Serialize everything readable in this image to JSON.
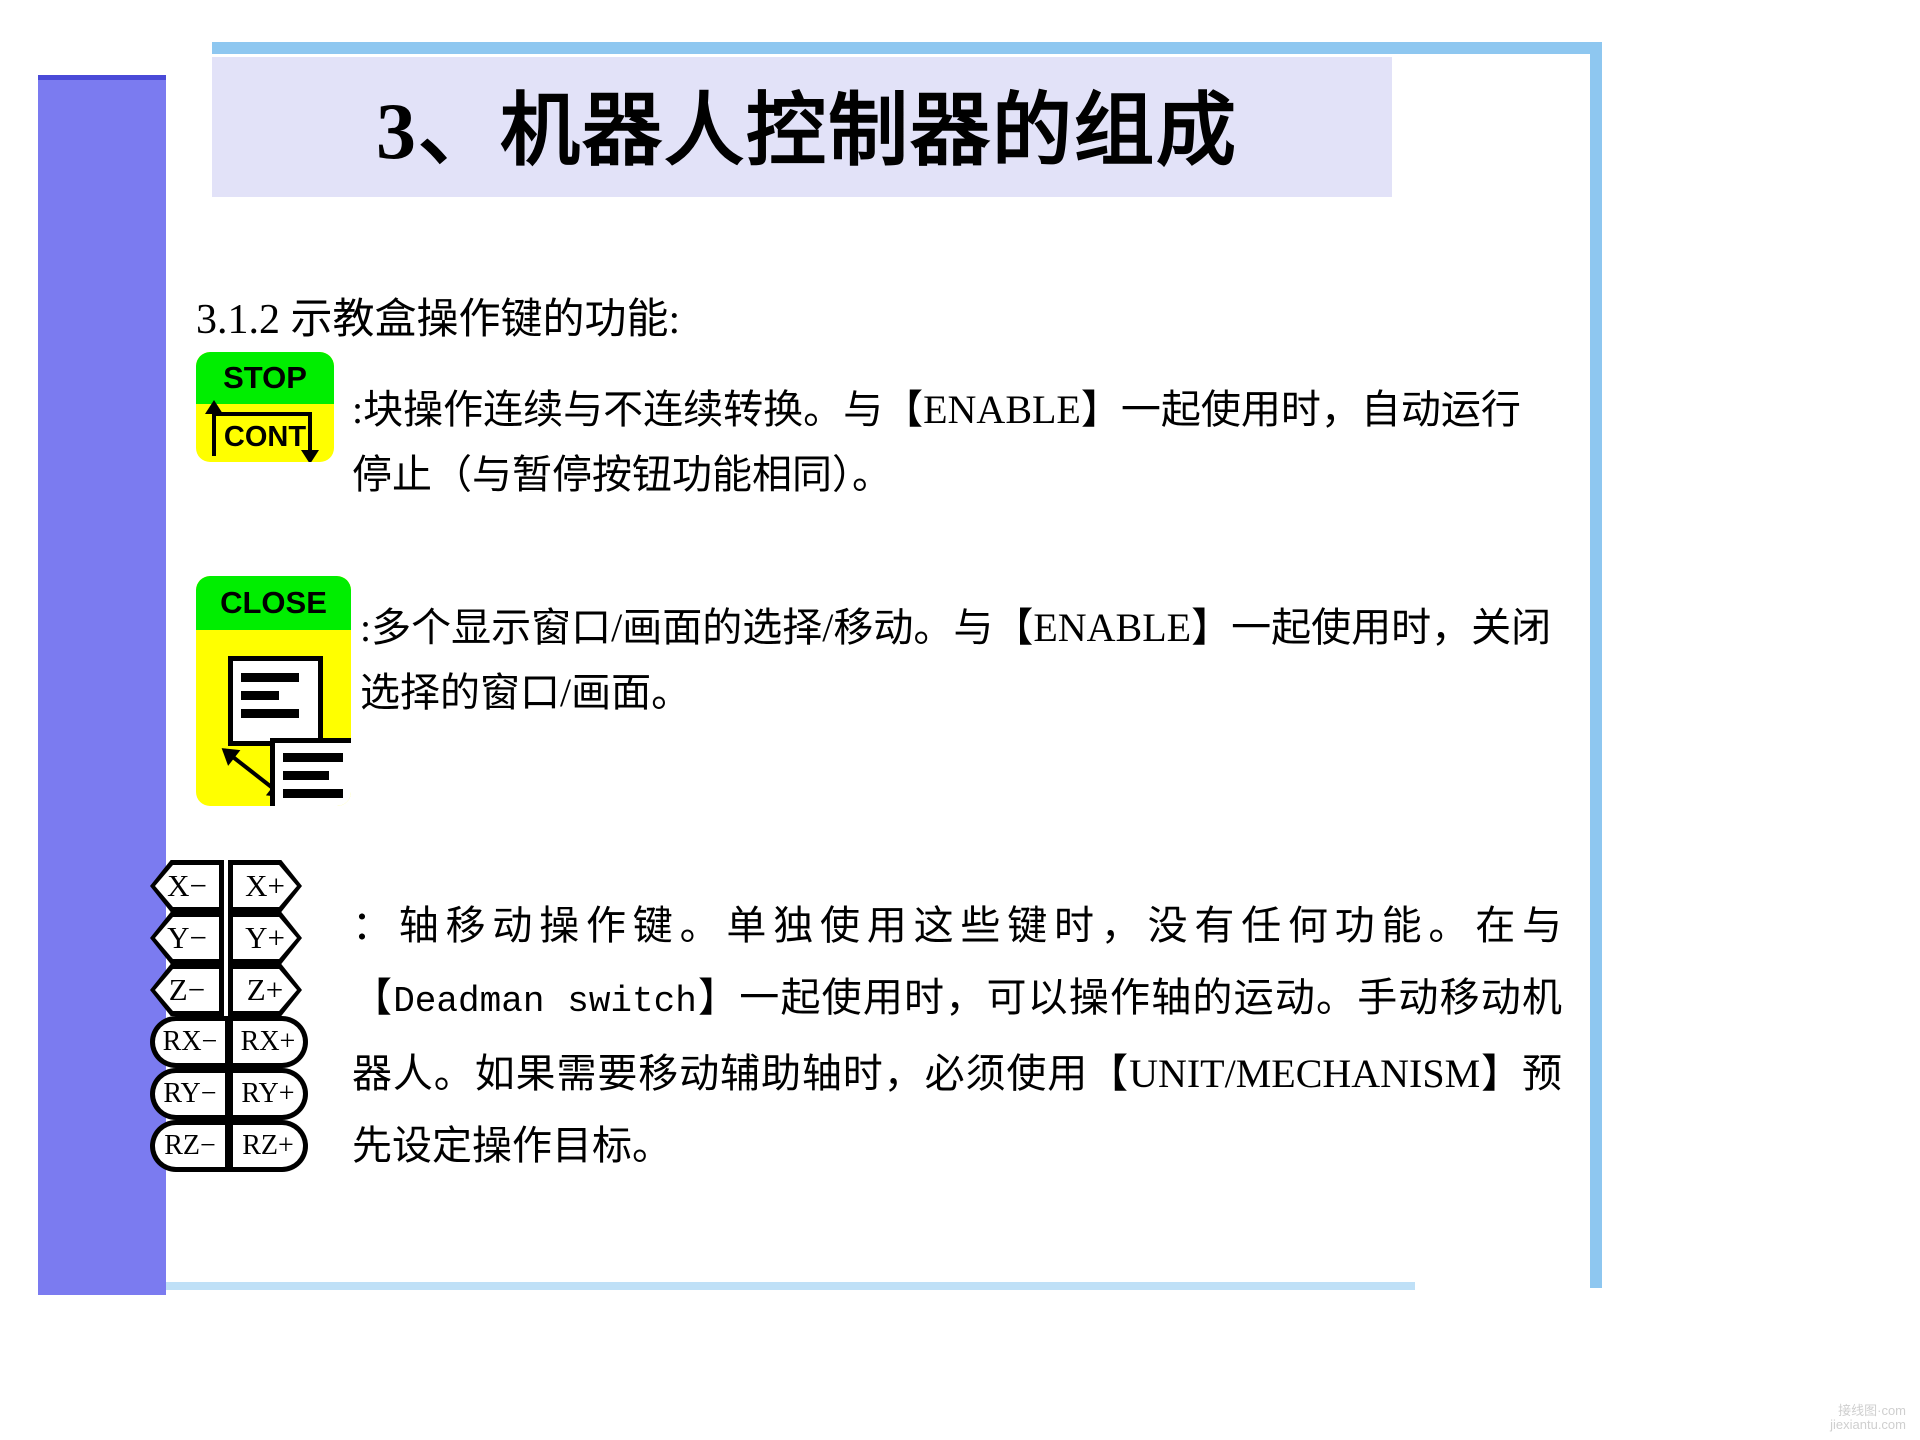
{
  "slide": {
    "title": "3、机器人控制器的组成",
    "subhead": "3.1.2  示教盒操作键的功能:",
    "paragraphs": {
      "stop_cont": ":块操作连续与不连续转换。与【ENABLE】一起使用时，自动运行停止（与暂停按钮功能相同）。",
      "close": ":多个显示窗口/画面的选择/移动。与【ENABLE】一起使用时，关闭选择的窗口/画面。",
      "axis_pre": "：轴移动操作键。单独使用这些键时，没有任何功能。在与【",
      "axis_mono": "Deadman switch",
      "axis_post": "】一起使用时，可以操作轴的运动。手动移动机器人。如果需要移动辅助轴时，必须使用【UNIT/MECHANISM】预先设定操作目标。"
    }
  },
  "keys": {
    "stop_label": "STOP",
    "cont_label": "CONT",
    "close_label": "CLOSE",
    "axis_rows": [
      {
        "minus": "X−",
        "plus": "X+",
        "shape": "pentagon"
      },
      {
        "minus": "Y−",
        "plus": "Y+",
        "shape": "pentagon"
      },
      {
        "minus": "Z−",
        "plus": "Z+",
        "shape": "pentagon"
      },
      {
        "minus": "RX−",
        "plus": "RX+",
        "shape": "capsule"
      },
      {
        "minus": "RY−",
        "plus": "RY+",
        "shape": "capsule"
      },
      {
        "minus": "RZ−",
        "plus": "RZ+",
        "shape": "capsule"
      }
    ]
  },
  "colors": {
    "banner": "#e2e2f8",
    "accent_blue": "#8ec7f0",
    "side_purple": "#7b7bf0",
    "key_green": "#00ee00",
    "key_yellow": "#ffff00"
  },
  "watermark": {
    "line1": "接线图·com",
    "line2": "jiexiantu.com"
  }
}
